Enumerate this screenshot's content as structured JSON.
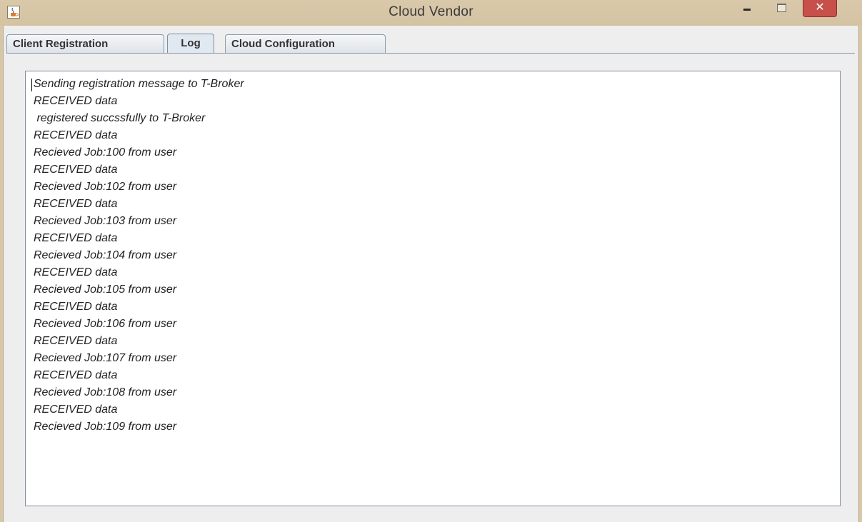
{
  "window": {
    "title": "Cloud Vendor",
    "minimize_symbol": "",
    "maximize_symbol": "",
    "close_symbol": "✕"
  },
  "tabs": [
    {
      "label": "Client Registration",
      "active": false
    },
    {
      "label": "Log",
      "active": true
    },
    {
      "label": "Cloud Configuration",
      "active": false
    }
  ],
  "log": {
    "lines": [
      "Sending registration message to T-Broker",
      "RECEIVED data",
      " registered succssfully to T-Broker",
      "RECEIVED data",
      "Recieved Job:100 from user",
      "RECEIVED data",
      "Recieved Job:102 from user",
      "RECEIVED data",
      "Recieved Job:103 from user",
      "RECEIVED data",
      "Recieved Job:104 from user",
      "RECEIVED data",
      "Recieved Job:105 from user",
      "RECEIVED data",
      "Recieved Job:106 from user",
      "RECEIVED data",
      "Recieved Job:107 from user",
      "RECEIVED data",
      "Recieved Job:108 from user",
      "RECEIVED data",
      "Recieved Job:109 from user"
    ]
  },
  "colors": {
    "titlebar": "#d7c7a9",
    "close_button": "#c7504a",
    "active_tab": "#e0e8f0",
    "panel_background": "#eeeeee"
  },
  "icons": {
    "app": "java-cup-icon"
  }
}
